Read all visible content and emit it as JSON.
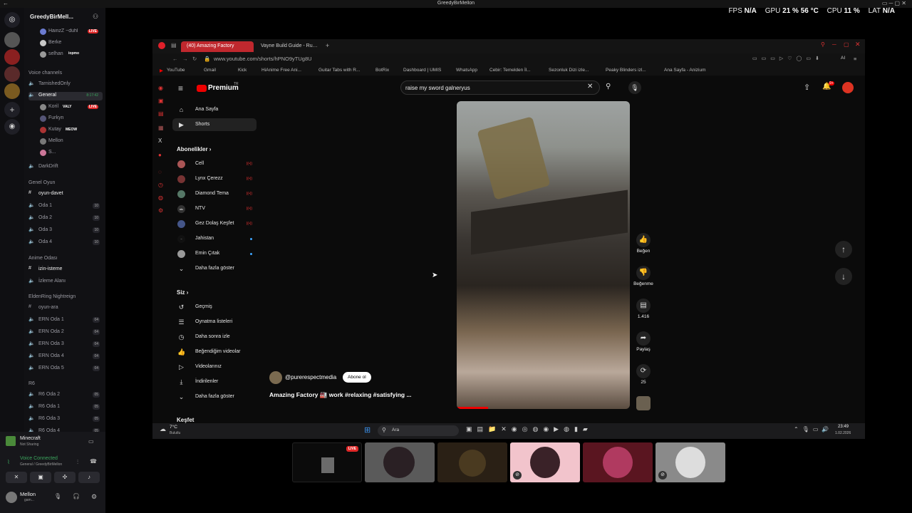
{
  "window": {
    "title": "GreedyBirMellon"
  },
  "stats": {
    "fps_label": "FPS",
    "fps_value": "N/A",
    "gpu_label": "GPU",
    "gpu_value": "21 % 56 °C",
    "cpu_label": "CPU",
    "cpu_value": "11 %",
    "lat_label": "LAT",
    "lat_value": "N/A"
  },
  "discord": {
    "server_name": "GreedyBirMell...",
    "top_members": [
      {
        "name": "HainzZ ~duhl",
        "live": "LIVE"
      },
      {
        "name": "Berke"
      },
      {
        "name": "selhan",
        "tag": "iopmo"
      }
    ],
    "voice_header": "Voice channels",
    "voice_channels": [
      {
        "name": "TarnishedOnly"
      },
      {
        "name": "General",
        "time": "8:17:42"
      }
    ],
    "general_members": [
      {
        "name": "Koril",
        "tag": "VALY",
        "live": "LIVE"
      },
      {
        "name": "Furkyn"
      },
      {
        "name": "Kutay",
        "tag": "MEOW"
      },
      {
        "name": "Mellon"
      },
      {
        "name": "S..."
      }
    ],
    "more_channels": [
      {
        "name": "DarkDrift"
      }
    ],
    "genel_header": "Genel Oyun",
    "genel_channels": [
      {
        "name": "oyun-davet",
        "type": "text"
      },
      {
        "name": "Oda 1",
        "count": "10"
      },
      {
        "name": "Oda 2",
        "count": "10"
      },
      {
        "name": "Oda 3",
        "count": "10"
      },
      {
        "name": "Oda 4",
        "count": "10"
      }
    ],
    "anime_header": "Anime Odası",
    "anime_channels": [
      {
        "name": "izin-isteme",
        "type": "text"
      },
      {
        "name": "İzleme Alanı"
      }
    ],
    "elden_header": "EldenRing Nightreign",
    "elden_channels": [
      {
        "name": "oyun-ara",
        "type": "text"
      },
      {
        "name": "ERN Oda 1",
        "count": "04"
      },
      {
        "name": "ERN Oda 2",
        "count": "04"
      },
      {
        "name": "ERN Oda 3",
        "count": "04"
      },
      {
        "name": "ERN Oda 4",
        "count": "04"
      },
      {
        "name": "ERN Oda 5",
        "count": "04"
      }
    ],
    "r6_header": "R6",
    "r6_channels": [
      {
        "name": "R6 Oda 2",
        "count": "05"
      },
      {
        "name": "R6 Oda 1",
        "count": "05"
      },
      {
        "name": "R6 Oda 3",
        "count": "05"
      },
      {
        "name": "R6 Oda 4",
        "count": "05"
      }
    ],
    "activity_game": "Minecraft",
    "activity_status": "Not Sharing",
    "voice_status": "Voice Connected",
    "voice_location": "General / GreedyBirMellon",
    "user_name": "Mellon",
    "user_status": "gam..."
  },
  "browser": {
    "tabs": [
      {
        "label": "(40) Amazing Factory"
      },
      {
        "label": "Vayne Build Guide - Rune"
      }
    ],
    "url": "www.youtube.com/shorts/hPNO9yTUg8U",
    "bookmarks": [
      "YouTube",
      "Gmail",
      "Kick",
      "HiAnime Free Ani...",
      "Guitar Tabs with R...",
      "BotRix",
      "Dashboard | UMIS",
      "WhatsApp",
      "Cebir: Temelden İl...",
      "Sezonluk Dizi izle...",
      "Peaky Blinders izl...",
      "Ana Sayfa - Anizium"
    ],
    "ai_label": "AI"
  },
  "youtube": {
    "logo": "Premium",
    "logo_tr": "TR",
    "search_value": "raise my sword galneryus",
    "notif_count": "9+",
    "nav_main": [
      {
        "label": "Ana Sayfa",
        "icon": "home-icon"
      },
      {
        "label": "Shorts",
        "icon": "shorts-icon"
      }
    ],
    "subs_header": "Abonelikler",
    "subs": [
      {
        "label": "Cell",
        "dot": "live"
      },
      {
        "label": "Lynx Çerezz",
        "dot": "live"
      },
      {
        "label": "Diamond Tema",
        "dot": "live"
      },
      {
        "label": "NTV",
        "dot": "live"
      },
      {
        "label": "Gez Dolaş Keşfet",
        "dot": "live"
      },
      {
        "label": "Jahistan",
        "dot": "new"
      },
      {
        "label": "Emin Çıtak",
        "dot": "new"
      },
      {
        "label": "Daha fazla göster"
      }
    ],
    "you_header": "Siz",
    "you_items": [
      {
        "label": "Geçmiş",
        "icon": "history-icon"
      },
      {
        "label": "Oynatma listeleri",
        "icon": "playlist-icon"
      },
      {
        "label": "Daha sonra izle",
        "icon": "clock-icon"
      },
      {
        "label": "Beğendiğim videolar",
        "icon": "thumb-up-icon"
      },
      {
        "label": "Videolarınız",
        "icon": "video-icon"
      },
      {
        "label": "İndirilenler",
        "icon": "download-icon"
      },
      {
        "label": "Daha fazla göster",
        "icon": "chevron-down-icon"
      }
    ],
    "explore_header": "Keşfet",
    "channel": "@purerespectmedia",
    "subscribe": "Abone ol",
    "video_title": "Amazing Factory 🏭 work #relaxing #satisfying ...",
    "actions": [
      {
        "label": "Beğen",
        "icon": "thumb-up-icon"
      },
      {
        "label": "Beğenme",
        "icon": "thumb-down-icon"
      },
      {
        "label": "1.416",
        "icon": "comment-icon"
      },
      {
        "label": "Paylaş",
        "icon": "share-icon"
      },
      {
        "label": "25",
        "icon": "remix-icon"
      }
    ]
  },
  "taskbar": {
    "weather_temp": "7°C",
    "weather_desc": "Bulutlu",
    "search_label": "Ara",
    "time": "23:49",
    "date": "1.02.2026"
  },
  "thumbs": {
    "live": "LIVE"
  }
}
